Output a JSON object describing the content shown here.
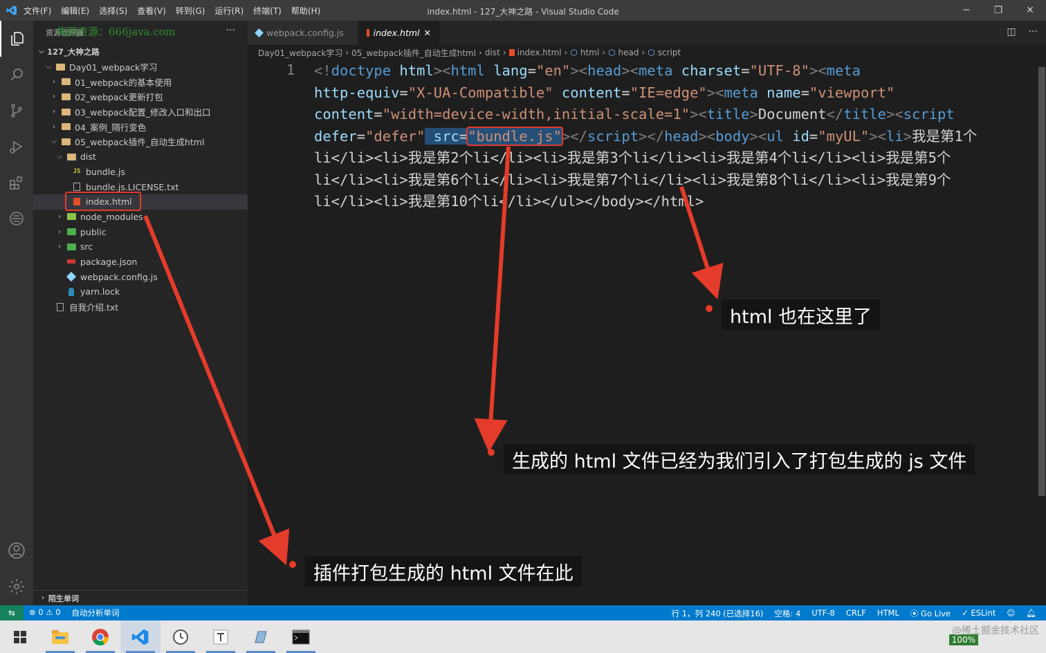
{
  "window": {
    "title": "index.html - 127_大神之路 - Visual Studio Code",
    "menu": [
      "文件(F)",
      "编辑(E)",
      "选择(S)",
      "查看(V)",
      "转到(G)",
      "运行(R)",
      "终端(T)",
      "帮助(H)"
    ]
  },
  "activity": [
    "explorer-icon",
    "search-icon",
    "source-control-icon",
    "run-debug-icon",
    "extensions-icon",
    "remote-icon",
    "account-icon",
    "settings-gear-icon"
  ],
  "sidebar": {
    "header": "资源管理器",
    "watermark": "梅园资源：666java.com",
    "root": "127_大神之路",
    "items": [
      {
        "label": "Day01_webpack学习"
      },
      {
        "label": "01_webpack的基本使用"
      },
      {
        "label": "02_webpack更新打包"
      },
      {
        "label": "03_webpack配置_修改入口和出口"
      },
      {
        "label": "04_案例_隔行变色"
      },
      {
        "label": "05_webpack插件_自动生成html"
      },
      {
        "label": "dist"
      },
      {
        "label": "bundle.js"
      },
      {
        "label": "bundle.js.LICENSE.txt"
      },
      {
        "label": "index.html"
      },
      {
        "label": "node_modules"
      },
      {
        "label": "public"
      },
      {
        "label": "src"
      },
      {
        "label": "package.json"
      },
      {
        "label": "webpack.config.js"
      },
      {
        "label": "yarn.lock"
      },
      {
        "label": "自我介绍.txt"
      }
    ],
    "footer": "陌生单词"
  },
  "tabs": [
    {
      "label": "webpack.config.js"
    },
    {
      "label": "index.html"
    }
  ],
  "breadcrumbs": [
    "Day01_webpack学习",
    "05_webpack插件_自动生成html",
    "dist",
    "index.html",
    "html",
    "head",
    "script"
  ],
  "editor": {
    "line_number": "1",
    "code": {
      "l1_a": "<!",
      "l1_b": "doctype",
      "l1_c": " html",
      "l1_d": "><",
      "l1_e": "html",
      "l1_f": " lang",
      "l1_g": "=",
      "l1_h": "\"en\"",
      "l1_i": "><",
      "l1_j": "head",
      "l1_k": "><",
      "l1_l": "meta",
      "l1_m": " charset",
      "l1_n": "=",
      "l1_o": "\"UTF-8\"",
      "l1_p": "><",
      "l1_q": "meta",
      "l2_a": "http-equiv",
      "l2_b": "=",
      "l2_c": "\"X-UA-Compatible\"",
      "l2_d": " content",
      "l2_e": "=",
      "l2_f": "\"IE=edge\"",
      "l2_g": "><",
      "l2_h": "meta",
      "l2_i": " name",
      "l2_j": "=",
      "l2_k": "\"viewport\"",
      "l3_a": "content",
      "l3_b": "=",
      "l3_c": "\"width=device-width,initial-scale=1\"",
      "l3_d": "><",
      "l3_e": "title",
      "l3_f": ">",
      "l3_g": "Document",
      "l3_h": "</",
      "l3_i": "title",
      "l3_j": "><",
      "l3_k": "script",
      "l4_a": "defer",
      "l4_b": "=",
      "l4_c": "\"defer\"",
      "l4_d": " src",
      "l4_e": "=",
      "l4_f": "\"bundle.js\"",
      "l4_g": "></",
      "l4_h": "script",
      "l4_i": "></",
      "l4_j": "head",
      "l4_k": "><",
      "l4_l": "body",
      "l4_m": "><",
      "l4_n": "ul",
      "l4_o": " id",
      "l4_p": "=",
      "l4_q": "\"myUL\"",
      "l4_r": "><",
      "l4_s": "li",
      "l4_t": ">",
      "l4_u": "我是第1个",
      "l5": "li</li><li>我是第2个li</li><li>我是第3个li</li><li>我是第4个li</li><li>我是第5个",
      "l6": "li</li><li>我是第6个li</li><li>我是第7个li</li><li>我是第8个li</li><li>我是第9个",
      "l7": "li</li><li>我是第10个li</li></ul></body></html>"
    }
  },
  "annotations": {
    "html_here": "html 也在这里了",
    "generated": "生成的 html 文件已经为我们引入了打包生成的 js 文件",
    "plugin": "插件打包生成的 html 文件在此"
  },
  "statusbar": {
    "problems": "⊗ 0 ⚠ 0",
    "task": "自动分析单词",
    "position": "行 1，列 240 (已选择16)",
    "spaces": "空格: 4",
    "encoding": "UTF-8",
    "eol": "CRLF",
    "language": "HTML",
    "golive": "Go Live",
    "eslint": "ESLint"
  },
  "taskbar": {
    "zoom": "100%",
    "watermark": "@稀土掘金技术社区"
  },
  "colors": {
    "accent": "#007acc",
    "annotation": "#e53b2b"
  }
}
